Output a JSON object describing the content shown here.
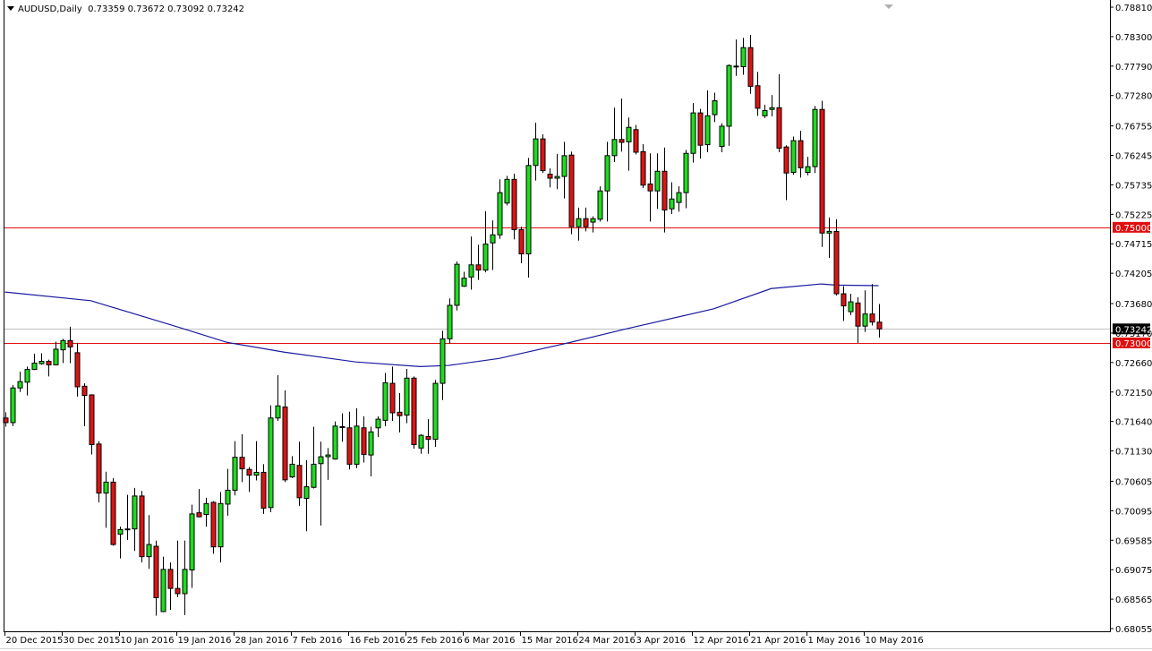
{
  "header": {
    "symbol_label": "AUDUSD,Daily",
    "ohlc_label": "0.73359 0.73672 0.73092 0.73242"
  },
  "chart_data": {
    "type": "candlestick",
    "title": "AUDUSD,Daily",
    "ylim": [
      0.68055,
      0.7881
    ],
    "y_ticks": [
      "0.78810",
      "0.78300",
      "0.77790",
      "0.77280",
      "0.76755",
      "0.76245",
      "0.75735",
      "0.75225",
      "0.74715",
      "0.74205",
      "0.73680",
      "0.73170",
      "0.72660",
      "0.72150",
      "0.71640",
      "0.71130",
      "0.70605",
      "0.70095",
      "0.69585",
      "0.69075",
      "0.68565",
      "0.68055"
    ],
    "x_labels": [
      "20 Dec 2015",
      "30 Dec 2015",
      "10 Jan 2016",
      "19 Jan 2016",
      "28 Jan 2016",
      "7 Feb 2016",
      "16 Feb 2016",
      "25 Feb 2016",
      "6 Mar 2016",
      "15 Mar 2016",
      "24 Mar 2016",
      "3 Apr 2016",
      "12 Apr 2016",
      "21 Apr 2016",
      "1 May 2016",
      "10 May 2016"
    ],
    "x_label_every_n_bars": 8,
    "horizontal_lines": [
      {
        "price": 0.75,
        "label": "0.75000",
        "color": "#e01010"
      },
      {
        "price": 0.73,
        "label": "0.73000",
        "color": "#e01010"
      }
    ],
    "current_price": {
      "price": 0.73242,
      "label": "0.73242",
      "color": "#000000",
      "line_color": "#c0c0c0"
    },
    "colors": {
      "bull": "#1edc1e",
      "bear": "#dc1414",
      "outline": "#000000",
      "ma": "#1a1aa0"
    },
    "moving_average": [
      [
        0,
        0.7388
      ],
      [
        12,
        0.7373
      ],
      [
        24,
        0.7328
      ],
      [
        31,
        0.7301
      ],
      [
        39,
        0.7284
      ],
      [
        49,
        0.7267
      ],
      [
        58,
        0.7259
      ],
      [
        62,
        0.7261
      ],
      [
        69,
        0.7273
      ],
      [
        79,
        0.7301
      ],
      [
        87,
        0.7325
      ],
      [
        99,
        0.7359
      ],
      [
        107,
        0.7394
      ],
      [
        114,
        0.7402
      ],
      [
        116,
        0.74
      ],
      [
        122,
        0.7399
      ]
    ],
    "ohlc": [
      [
        0.717,
        0.718,
        0.7155,
        0.7162
      ],
      [
        0.7162,
        0.7227,
        0.7156,
        0.7222
      ],
      [
        0.7222,
        0.725,
        0.7215,
        0.7233
      ],
      [
        0.7232,
        0.7259,
        0.7209,
        0.7254
      ],
      [
        0.7254,
        0.7281,
        0.7253,
        0.7265
      ],
      [
        0.7264,
        0.7282,
        0.7262,
        0.7268
      ],
      [
        0.7268,
        0.7271,
        0.7242,
        0.7262
      ],
      [
        0.7262,
        0.7302,
        0.7261,
        0.7289
      ],
      [
        0.7288,
        0.7307,
        0.7265,
        0.7304
      ],
      [
        0.7304,
        0.7328,
        0.7265,
        0.7293
      ],
      [
        0.7283,
        0.73,
        0.7207,
        0.7224
      ],
      [
        0.7225,
        0.723,
        0.7156,
        0.7209
      ],
      [
        0.721,
        0.7211,
        0.7107,
        0.7124
      ],
      [
        0.7125,
        0.713,
        0.7024,
        0.704
      ],
      [
        0.704,
        0.7077,
        0.698,
        0.7059
      ],
      [
        0.7059,
        0.7066,
        0.6949,
        0.6951
      ],
      [
        0.6969,
        0.6982,
        0.6927,
        0.6977
      ],
      [
        0.6978,
        0.7037,
        0.6959,
        0.6977
      ],
      [
        0.6978,
        0.7049,
        0.694,
        0.7035
      ],
      [
        0.7035,
        0.7044,
        0.692,
        0.693
      ],
      [
        0.693,
        0.7002,
        0.6909,
        0.6951
      ],
      [
        0.6948,
        0.6958,
        0.6828,
        0.6859
      ],
      [
        0.6835,
        0.693,
        0.6834,
        0.6908
      ],
      [
        0.6908,
        0.692,
        0.6838,
        0.6875
      ],
      [
        0.6875,
        0.6958,
        0.686,
        0.6866
      ],
      [
        0.6866,
        0.6958,
        0.6829,
        0.6908
      ],
      [
        0.6907,
        0.702,
        0.6876,
        0.7004
      ],
      [
        0.7006,
        0.7047,
        0.6998,
        0.6999
      ],
      [
        0.7003,
        0.7032,
        0.6982,
        0.7022
      ],
      [
        0.7024,
        0.7026,
        0.6935,
        0.6947
      ],
      [
        0.6947,
        0.7042,
        0.692,
        0.7022
      ],
      [
        0.7021,
        0.7082,
        0.7001,
        0.7045
      ],
      [
        0.7045,
        0.713,
        0.7036,
        0.7102
      ],
      [
        0.7102,
        0.7142,
        0.7059,
        0.7082
      ],
      [
        0.7081,
        0.7085,
        0.7042,
        0.7071
      ],
      [
        0.7071,
        0.713,
        0.7062,
        0.7076
      ],
      [
        0.7076,
        0.709,
        0.7004,
        0.7014
      ],
      [
        0.7015,
        0.7192,
        0.7007,
        0.717
      ],
      [
        0.717,
        0.7244,
        0.7165,
        0.7191
      ],
      [
        0.7189,
        0.7218,
        0.7059,
        0.7063
      ],
      [
        0.7068,
        0.7104,
        0.7066,
        0.709
      ],
      [
        0.7088,
        0.7129,
        0.7018,
        0.7032
      ],
      [
        0.7031,
        0.7097,
        0.6974,
        0.7051
      ],
      [
        0.705,
        0.7155,
        0.7048,
        0.709
      ],
      [
        0.7091,
        0.7129,
        0.6984,
        0.7103
      ],
      [
        0.7103,
        0.7118,
        0.7063,
        0.7106
      ],
      [
        0.7099,
        0.7164,
        0.7098,
        0.7156
      ],
      [
        0.7155,
        0.7178,
        0.7129,
        0.7154
      ],
      [
        0.7153,
        0.7181,
        0.7081,
        0.709
      ],
      [
        0.709,
        0.7187,
        0.7083,
        0.7156
      ],
      [
        0.7153,
        0.7173,
        0.7093,
        0.7107
      ],
      [
        0.7106,
        0.7155,
        0.7069,
        0.7146
      ],
      [
        0.7153,
        0.7173,
        0.7137,
        0.7168
      ],
      [
        0.7166,
        0.7248,
        0.7156,
        0.7231
      ],
      [
        0.723,
        0.7259,
        0.7165,
        0.7179
      ],
      [
        0.718,
        0.7213,
        0.7145,
        0.7174
      ],
      [
        0.7175,
        0.7255,
        0.7161,
        0.7239
      ],
      [
        0.7239,
        0.7242,
        0.7117,
        0.7124
      ],
      [
        0.7118,
        0.7142,
        0.7108,
        0.714
      ],
      [
        0.7138,
        0.7168,
        0.7108,
        0.7133
      ],
      [
        0.7133,
        0.7236,
        0.712,
        0.723
      ],
      [
        0.723,
        0.7321,
        0.7201,
        0.7307
      ],
      [
        0.7307,
        0.7377,
        0.7299,
        0.7365
      ],
      [
        0.7365,
        0.7441,
        0.7356,
        0.7436
      ],
      [
        0.7398,
        0.7423,
        0.7397,
        0.7412
      ],
      [
        0.7414,
        0.7484,
        0.7392,
        0.7435
      ],
      [
        0.7435,
        0.747,
        0.7409,
        0.7426
      ],
      [
        0.7426,
        0.7528,
        0.7422,
        0.7471
      ],
      [
        0.7473,
        0.7512,
        0.7426,
        0.7487
      ],
      [
        0.7487,
        0.7583,
        0.748,
        0.756
      ],
      [
        0.7542,
        0.7589,
        0.7538,
        0.7583
      ],
      [
        0.7583,
        0.7593,
        0.7479,
        0.7496
      ],
      [
        0.7496,
        0.7501,
        0.7438,
        0.7454
      ],
      [
        0.7454,
        0.762,
        0.7413,
        0.7607
      ],
      [
        0.7607,
        0.7681,
        0.7581,
        0.7653
      ],
      [
        0.7653,
        0.7661,
        0.7594,
        0.7598
      ],
      [
        0.7592,
        0.7602,
        0.7569,
        0.7585
      ],
      [
        0.7585,
        0.7627,
        0.7566,
        0.7588
      ],
      [
        0.7588,
        0.7648,
        0.755,
        0.7624
      ],
      [
        0.7625,
        0.7631,
        0.7488,
        0.7501
      ],
      [
        0.7501,
        0.7534,
        0.7477,
        0.7515
      ],
      [
        0.7515,
        0.7534,
        0.7493,
        0.7501
      ],
      [
        0.7509,
        0.7519,
        0.7491,
        0.7515
      ],
      [
        0.7514,
        0.7571,
        0.751,
        0.7563
      ],
      [
        0.7563,
        0.7648,
        0.751,
        0.7624
      ],
      [
        0.7624,
        0.7707,
        0.7613,
        0.7652
      ],
      [
        0.7652,
        0.7723,
        0.7631,
        0.7647
      ],
      [
        0.7648,
        0.769,
        0.7598,
        0.7673
      ],
      [
        0.7669,
        0.7677,
        0.7626,
        0.763
      ],
      [
        0.7631,
        0.7644,
        0.7568,
        0.7573
      ],
      [
        0.7575,
        0.7628,
        0.751,
        0.7563
      ],
      [
        0.7563,
        0.7628,
        0.7532,
        0.7597
      ],
      [
        0.7597,
        0.7638,
        0.7491,
        0.753
      ],
      [
        0.7532,
        0.7578,
        0.7523,
        0.7549
      ],
      [
        0.7543,
        0.7571,
        0.7527,
        0.756
      ],
      [
        0.756,
        0.7634,
        0.7533,
        0.7628
      ],
      [
        0.7628,
        0.7715,
        0.7612,
        0.7698
      ],
      [
        0.7698,
        0.7705,
        0.7619,
        0.7642
      ],
      [
        0.7643,
        0.7737,
        0.763,
        0.7693
      ],
      [
        0.7695,
        0.7733,
        0.7682,
        0.7719
      ],
      [
        0.764,
        0.768,
        0.763,
        0.7675
      ],
      [
        0.7675,
        0.7782,
        0.7641,
        0.778
      ],
      [
        0.7778,
        0.7825,
        0.7762,
        0.7779
      ],
      [
        0.7778,
        0.7828,
        0.7764,
        0.7811
      ],
      [
        0.7811,
        0.7833,
        0.7731,
        0.7744
      ],
      [
        0.7745,
        0.7769,
        0.7693,
        0.7706
      ],
      [
        0.7693,
        0.7712,
        0.7689,
        0.7702
      ],
      [
        0.7704,
        0.7729,
        0.7692,
        0.7707
      ],
      [
        0.7707,
        0.7765,
        0.763,
        0.7637
      ],
      [
        0.7639,
        0.7642,
        0.7547,
        0.7594
      ],
      [
        0.7595,
        0.7657,
        0.7591,
        0.765
      ],
      [
        0.765,
        0.7667,
        0.7586,
        0.7603
      ],
      [
        0.7595,
        0.7622,
        0.759,
        0.7605
      ],
      [
        0.7605,
        0.771,
        0.7594,
        0.7704
      ],
      [
        0.7704,
        0.7719,
        0.7466,
        0.749
      ],
      [
        0.749,
        0.7517,
        0.7447,
        0.7493
      ],
      [
        0.7493,
        0.7514,
        0.7382,
        0.7385
      ],
      [
        0.7385,
        0.7398,
        0.7338,
        0.7364
      ],
      [
        0.7354,
        0.7385,
        0.7348,
        0.7371
      ],
      [
        0.7369,
        0.7379,
        0.73,
        0.7329
      ],
      [
        0.7329,
        0.7391,
        0.7319,
        0.735
      ],
      [
        0.735,
        0.7402,
        0.733,
        0.7336
      ],
      [
        0.73359,
        0.73672,
        0.73092,
        0.73242
      ]
    ]
  }
}
